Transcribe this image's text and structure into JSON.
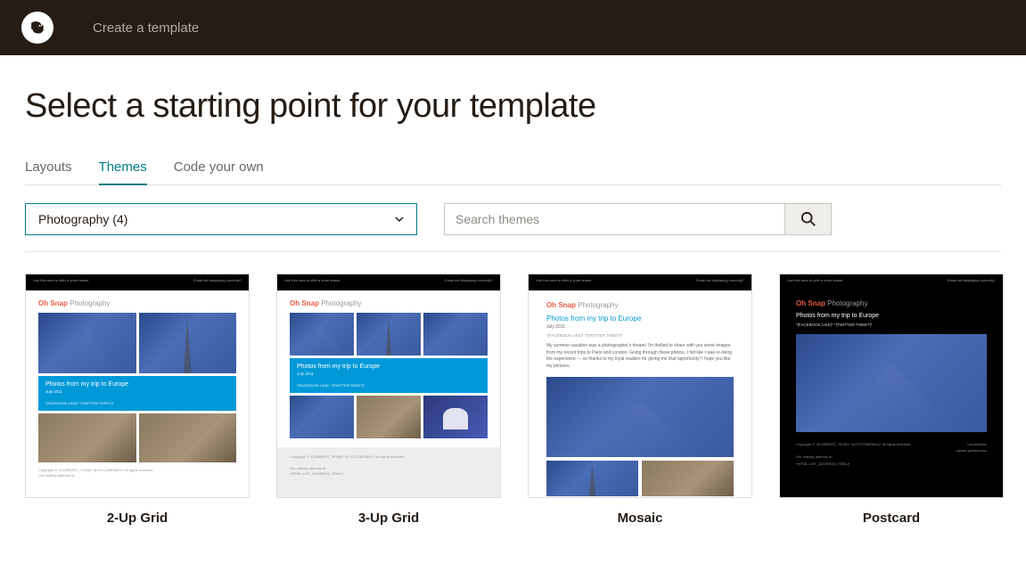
{
  "header": {
    "title": "Create a template"
  },
  "page": {
    "title": "Select a starting point for your template"
  },
  "tabs": [
    {
      "label": "Layouts",
      "active": false
    },
    {
      "label": "Themes",
      "active": true
    },
    {
      "label": "Code your own",
      "active": false
    }
  ],
  "filter": {
    "selected": "Photography (4)"
  },
  "search": {
    "placeholder": "Search themes"
  },
  "templates": [
    {
      "name": "2-Up Grid"
    },
    {
      "name": "3-Up Grid"
    },
    {
      "name": "Mosaic"
    },
    {
      "name": "Postcard"
    }
  ],
  "preview": {
    "brand_primary": "Oh Snap",
    "brand_secondary": "Photography",
    "headline": "Photos from my trip to Europe",
    "date": "July 2011",
    "social": "*|FACEBOOK:LIKE|* *|TWITTER:TWEET|*"
  }
}
